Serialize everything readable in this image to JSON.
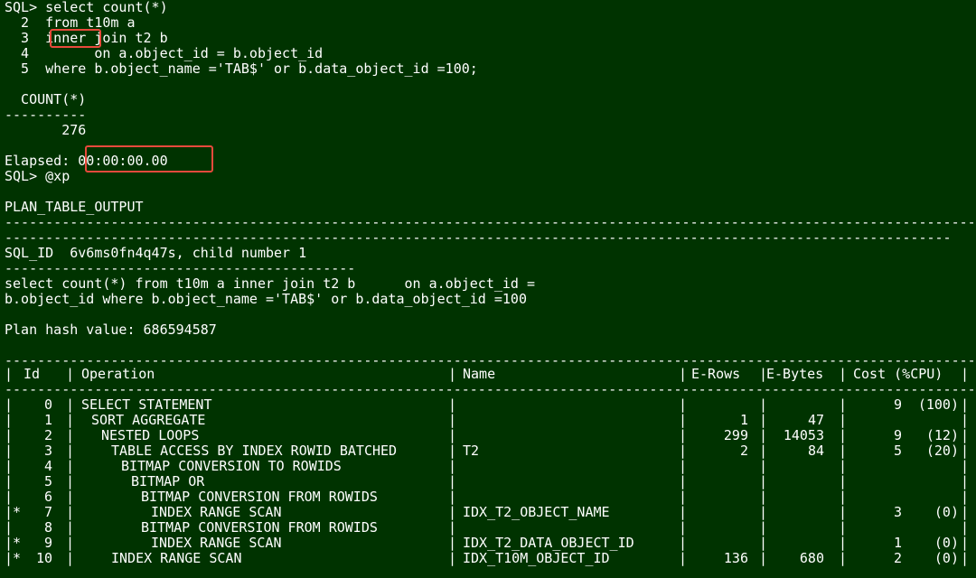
{
  "terminal": {
    "query_lines": [
      "SQL> select count(*)",
      "  2  from t10m a",
      "  3  inner join t2 b",
      "  4        on a.object_id = b.object_id",
      "  5  where b.object_name ='TAB$' or b.data_object_id =100;"
    ],
    "result_header": "  COUNT(*)",
    "result_dash": "----------",
    "result_value": "       276",
    "elapsed_label": "Elapsed: ",
    "elapsed_value": "00:00:00.00",
    "xp_prompt": "SQL> @xp",
    "plan_table_output": "PLAN_TABLE_OUTPUT",
    "sql_id_line": "SQL_ID  6v6ms0fn4q47s, child number 1",
    "sql_text_line1": "select count(*) from t10m a inner join t2 b      on a.object_id =",
    "sql_text_line2": "b.object_id where b.object_name ='TAB$' or b.data_object_id =100",
    "plan_hash_line": "Plan hash value: 686594587",
    "highlight_color": "#e84a3c",
    "background_color": "#003300"
  },
  "plan": {
    "headers": {
      "id": "Id",
      "operation": "Operation",
      "name": "Name",
      "rows": "E-Rows",
      "bytes": "E-Bytes",
      "cost": "Cost (%CPU)"
    },
    "rows": [
      {
        "star": "",
        "id": "0",
        "op": "SELECT STATEMENT",
        "indent": 0,
        "name": "",
        "rows": "",
        "bytes": "",
        "cost": "9",
        "cpu": "(100)"
      },
      {
        "star": "",
        "id": "1",
        "op": "SORT AGGREGATE",
        "indent": 1,
        "name": "",
        "rows": "1",
        "bytes": "47",
        "cost": "",
        "cpu": ""
      },
      {
        "star": "",
        "id": "2",
        "op": "NESTED LOOPS",
        "indent": 2,
        "name": "",
        "rows": "299",
        "bytes": "14053",
        "cost": "9",
        "cpu": "(12)"
      },
      {
        "star": "",
        "id": "3",
        "op": "TABLE ACCESS BY INDEX ROWID BATCHED",
        "indent": 3,
        "name": "T2",
        "rows": "2",
        "bytes": "84",
        "cost": "5",
        "cpu": "(20)"
      },
      {
        "star": "",
        "id": "4",
        "op": "BITMAP CONVERSION TO ROWIDS",
        "indent": 4,
        "name": "",
        "rows": "",
        "bytes": "",
        "cost": "",
        "cpu": ""
      },
      {
        "star": "",
        "id": "5",
        "op": "BITMAP OR",
        "indent": 5,
        "name": "",
        "rows": "",
        "bytes": "",
        "cost": "",
        "cpu": ""
      },
      {
        "star": "",
        "id": "6",
        "op": "BITMAP CONVERSION FROM ROWIDS",
        "indent": 6,
        "name": "",
        "rows": "",
        "bytes": "",
        "cost": "",
        "cpu": ""
      },
      {
        "star": "*",
        "id": "7",
        "op": "INDEX RANGE SCAN",
        "indent": 7,
        "name": "IDX_T2_OBJECT_NAME",
        "rows": "",
        "bytes": "",
        "cost": "3",
        "cpu": "(0)"
      },
      {
        "star": "",
        "id": "8",
        "op": "BITMAP CONVERSION FROM ROWIDS",
        "indent": 6,
        "name": "",
        "rows": "",
        "bytes": "",
        "cost": "",
        "cpu": ""
      },
      {
        "star": "*",
        "id": "9",
        "op": "INDEX RANGE SCAN",
        "indent": 7,
        "name": "IDX_T2_DATA_OBJECT_ID",
        "rows": "",
        "bytes": "",
        "cost": "1",
        "cpu": "(0)"
      },
      {
        "star": "*",
        "id": "10",
        "op": "INDEX RANGE SCAN",
        "indent": 3,
        "name": "IDX_T10M_OBJECT_ID",
        "rows": "136",
        "bytes": "680",
        "cost": "2",
        "cpu": "(0)"
      }
    ]
  }
}
